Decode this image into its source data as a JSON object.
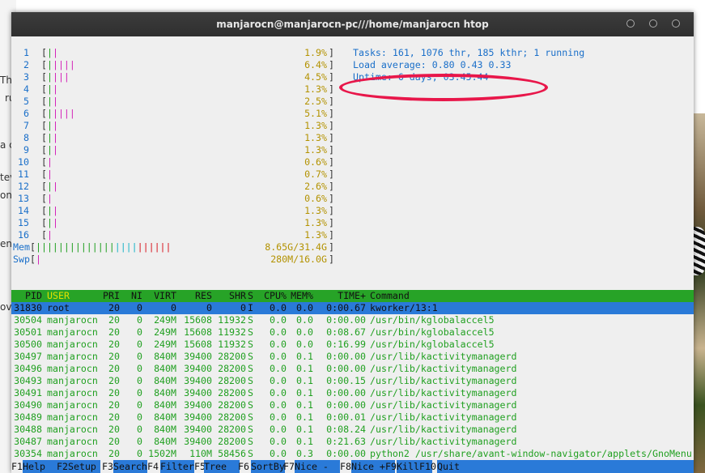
{
  "window": {
    "title": "manjarocn@manjarocn-pc///home/manjarocn htop"
  },
  "background_doc": {
    "fragments": [
      "Tha",
      "ru",
      "a c",
      "tev",
      "on",
      "end",
      "ov"
    ]
  },
  "cpus": [
    {
      "num": "1",
      "bar": [
        [
          "g",
          "|"
        ],
        [
          "m",
          "|"
        ]
      ],
      "val": "1.9%"
    },
    {
      "num": "2",
      "bar": [
        [
          "g",
          "|"
        ],
        [
          "m",
          "||||"
        ]
      ],
      "val": "6.4%"
    },
    {
      "num": "3",
      "bar": [
        [
          "g",
          "|"
        ],
        [
          "m",
          "|||"
        ]
      ],
      "val": "4.5%"
    },
    {
      "num": "4",
      "bar": [
        [
          "g",
          "|"
        ],
        [
          "m",
          "|"
        ]
      ],
      "val": "1.3%"
    },
    {
      "num": "5",
      "bar": [
        [
          "g",
          "|"
        ],
        [
          "m",
          "|"
        ]
      ],
      "val": "2.5%"
    },
    {
      "num": "6",
      "bar": [
        [
          "g",
          "|"
        ],
        [
          "m",
          "||||"
        ]
      ],
      "val": "5.1%"
    },
    {
      "num": "7",
      "bar": [
        [
          "g",
          "|"
        ],
        [
          "m",
          "|"
        ]
      ],
      "val": "1.3%"
    },
    {
      "num": "8",
      "bar": [
        [
          "g",
          "|"
        ],
        [
          "m",
          "|"
        ]
      ],
      "val": "1.3%"
    },
    {
      "num": "9",
      "bar": [
        [
          "g",
          "|"
        ],
        [
          "m",
          "|"
        ]
      ],
      "val": "1.3%"
    },
    {
      "num": "10",
      "bar": [
        [
          "m",
          "|"
        ]
      ],
      "val": "0.6%"
    },
    {
      "num": "11",
      "bar": [
        [
          "m",
          "|"
        ]
      ],
      "val": "0.7%"
    },
    {
      "num": "12",
      "bar": [
        [
          "g",
          "|"
        ],
        [
          "m",
          "|"
        ]
      ],
      "val": "2.6%"
    },
    {
      "num": "13",
      "bar": [
        [
          "m",
          "|"
        ]
      ],
      "val": "0.6%"
    },
    {
      "num": "14",
      "bar": [
        [
          "g",
          "|"
        ],
        [
          "m",
          "|"
        ]
      ],
      "val": "1.3%"
    },
    {
      "num": "15",
      "bar": [
        [
          "g",
          "|"
        ],
        [
          "m",
          "|"
        ]
      ],
      "val": "1.3%"
    },
    {
      "num": "16",
      "bar": [
        [
          "m",
          "|"
        ]
      ],
      "val": "1.3%"
    }
  ],
  "mem": {
    "label": "Mem",
    "bar": [
      [
        "g",
        "||||||||||||||"
      ],
      [
        "c",
        "||||"
      ],
      [
        "r",
        "||||||"
      ]
    ],
    "val": "8.65G/31.4G"
  },
  "swp": {
    "label": "Swp",
    "bar": [
      [
        "m",
        "|"
      ]
    ],
    "val": "280M/16.0G"
  },
  "info": {
    "tasks": "Tasks: 161, 1076 thr, 185 kthr; 1 running",
    "load": "Load average: 0.80 0.43 0.33",
    "uptime": "Uptime: 6 days, 03:45:44"
  },
  "columns": [
    "PID",
    "USER",
    "PRI",
    "NI",
    "VIRT",
    "RES",
    "SHR",
    "S",
    "CPU%",
    "MEM%",
    "TIME+",
    "Command"
  ],
  "processes": [
    [
      "31830",
      "root",
      "20",
      "0",
      "0",
      "0",
      "0",
      "I",
      "0.0",
      "0.0",
      "0:00.67",
      "kworker/13:1"
    ],
    [
      "30504",
      "manjarocn",
      "20",
      "0",
      "249M",
      "15608",
      "11932",
      "S",
      "0.0",
      "0.0",
      "0:00.00",
      "/usr/bin/kglobalaccel5"
    ],
    [
      "30501",
      "manjarocn",
      "20",
      "0",
      "249M",
      "15608",
      "11932",
      "S",
      "0.0",
      "0.0",
      "0:08.67",
      "/usr/bin/kglobalaccel5"
    ],
    [
      "30500",
      "manjarocn",
      "20",
      "0",
      "249M",
      "15608",
      "11932",
      "S",
      "0.0",
      "0.0",
      "0:16.99",
      "/usr/bin/kglobalaccel5"
    ],
    [
      "30497",
      "manjarocn",
      "20",
      "0",
      "840M",
      "39400",
      "28200",
      "S",
      "0.0",
      "0.1",
      "0:00.00",
      "/usr/lib/kactivitymanagerd"
    ],
    [
      "30496",
      "manjarocn",
      "20",
      "0",
      "840M",
      "39400",
      "28200",
      "S",
      "0.0",
      "0.1",
      "0:00.00",
      "/usr/lib/kactivitymanagerd"
    ],
    [
      "30493",
      "manjarocn",
      "20",
      "0",
      "840M",
      "39400",
      "28200",
      "S",
      "0.0",
      "0.1",
      "0:00.15",
      "/usr/lib/kactivitymanagerd"
    ],
    [
      "30491",
      "manjarocn",
      "20",
      "0",
      "840M",
      "39400",
      "28200",
      "S",
      "0.0",
      "0.1",
      "0:00.00",
      "/usr/lib/kactivitymanagerd"
    ],
    [
      "30490",
      "manjarocn",
      "20",
      "0",
      "840M",
      "39400",
      "28200",
      "S",
      "0.0",
      "0.1",
      "0:00.00",
      "/usr/lib/kactivitymanagerd"
    ],
    [
      "30489",
      "manjarocn",
      "20",
      "0",
      "840M",
      "39400",
      "28200",
      "S",
      "0.0",
      "0.1",
      "0:00.01",
      "/usr/lib/kactivitymanagerd"
    ],
    [
      "30488",
      "manjarocn",
      "20",
      "0",
      "840M",
      "39400",
      "28200",
      "S",
      "0.0",
      "0.1",
      "0:08.24",
      "/usr/lib/kactivitymanagerd"
    ],
    [
      "30487",
      "manjarocn",
      "20",
      "0",
      "840M",
      "39400",
      "28200",
      "S",
      "0.0",
      "0.1",
      "0:21.63",
      "/usr/lib/kactivitymanagerd"
    ],
    [
      "30354",
      "manjarocn",
      "20",
      "0",
      "1502M",
      "110M",
      "58456",
      "S",
      "0.0",
      "0.3",
      "0:00.00",
      "python2 /usr/share/avant-window-navigator/applets/GnoMenu"
    ]
  ],
  "function_keys": [
    {
      "key": "F1",
      "label": "Help"
    },
    {
      "key": "F2",
      "label": "Setup"
    },
    {
      "key": "F3",
      "label": "Search"
    },
    {
      "key": "F4",
      "label": "Filter"
    },
    {
      "key": "F5",
      "label": "Tree"
    },
    {
      "key": "F6",
      "label": "SortBy"
    },
    {
      "key": "F7",
      "label": "Nice -"
    },
    {
      "key": "F8",
      "label": "Nice +"
    },
    {
      "key": "F9",
      "label": "Kill"
    },
    {
      "key": "F10",
      "label": "Quit"
    }
  ],
  "colors": {
    "header_bg": "#27a327",
    "selected_bg": "#2a7ad8",
    "annotation": "#e8174a",
    "cpu_num": "#1a6fc9",
    "value": "#b39200"
  }
}
